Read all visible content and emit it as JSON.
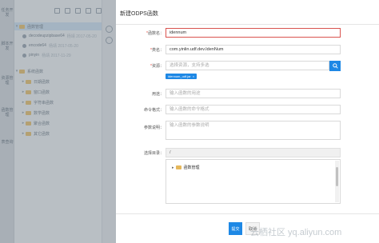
{
  "left_nav": {
    "items": [
      "任务开发",
      "脚本开发",
      "资源管理",
      "函数管理",
      "表查询"
    ]
  },
  "tree": {
    "items": [
      {
        "label": "函数管理",
        "type": "folder",
        "meta": ""
      },
      {
        "label": "decodeupzipbase64",
        "type": "function",
        "meta": "杨靖 2017-05-20"
      },
      {
        "label": "encode64",
        "type": "function",
        "meta": "杨靖 2017-05-20"
      },
      {
        "label": "pinyin",
        "type": "function",
        "meta": "杨靖 2017-11-29"
      },
      {
        "label": "系统函数",
        "type": "folder",
        "meta": ""
      },
      {
        "label": "日期函数",
        "type": "folder",
        "meta": ""
      },
      {
        "label": "窗口函数",
        "type": "folder",
        "meta": ""
      },
      {
        "label": "字符串函数",
        "type": "folder",
        "meta": ""
      },
      {
        "label": "数学函数",
        "type": "folder",
        "meta": ""
      },
      {
        "label": "聚合函数",
        "type": "folder",
        "meta": ""
      },
      {
        "label": "其它函数",
        "type": "folder",
        "meta": ""
      }
    ]
  },
  "modal": {
    "title": "新建ODPS函数",
    "fields": {
      "func_name": {
        "label": "函数名：",
        "value": "idennum"
      },
      "class_name": {
        "label": "类名：",
        "value": "com.yinlin.udf.dev.IdenNum"
      },
      "resource": {
        "label": "资源：",
        "placeholder": "选择资源，支持多选",
        "tag": "idennum_udf.jar"
      },
      "usage": {
        "label": "用途：",
        "placeholder": "输入函数的用途"
      },
      "cmd_format": {
        "label": "命令格式：",
        "placeholder": "输入函数的命令格式"
      },
      "param_desc": {
        "label": "参数说明：",
        "placeholder": "输入函数的参数说明"
      },
      "dir": {
        "label": "选择目录：",
        "path": "/",
        "node": "函数管理"
      }
    },
    "ok_label": "提交",
    "cancel_label": "取消"
  },
  "watermark": "云栖社区 yq.aliyun.com",
  "colors": {
    "accent": "#1e88e5",
    "error_border": "#d9534f",
    "required": "#e74c3c"
  }
}
